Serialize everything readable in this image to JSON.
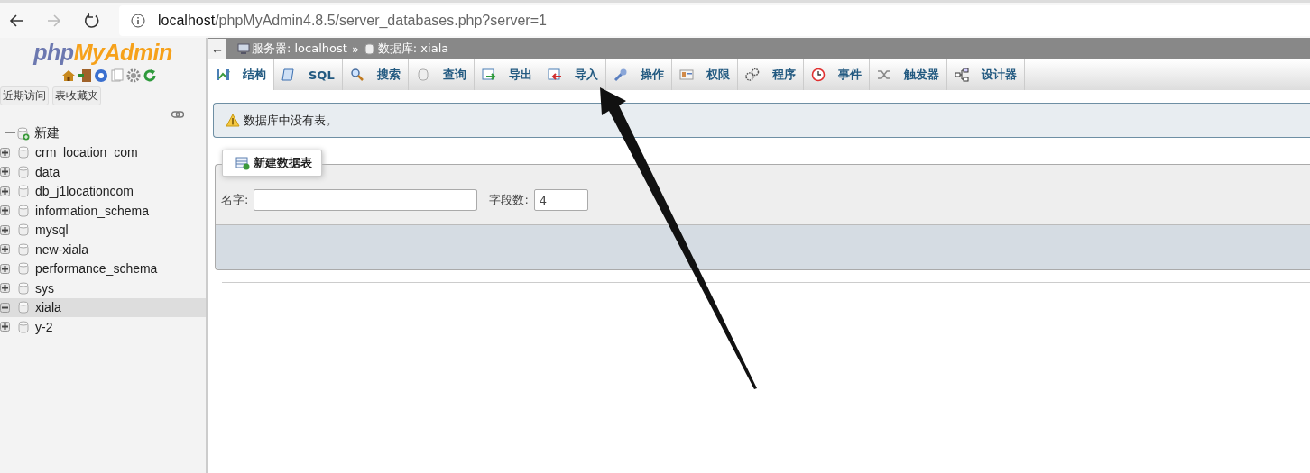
{
  "browser": {
    "url_host": "localhost",
    "url_path": "/phpMyAdmin4.8.5/server_databases.php?server=1"
  },
  "sidebar": {
    "logo_php": "php",
    "logo_myadmin": "MyAdmin",
    "buttons": [
      {
        "label": "近期访问"
      },
      {
        "label": "表收藏夹"
      }
    ],
    "tree": [
      {
        "kind": "new",
        "label": "新建",
        "selected": false
      },
      {
        "kind": "database",
        "label": "crm_location_com",
        "expanded": false,
        "selected": false
      },
      {
        "kind": "database",
        "label": "data",
        "expanded": false,
        "selected": false
      },
      {
        "kind": "database",
        "label": "db_j1locationcom",
        "expanded": false,
        "selected": false
      },
      {
        "kind": "database",
        "label": "information_schema",
        "expanded": false,
        "selected": false
      },
      {
        "kind": "database",
        "label": "mysql",
        "expanded": false,
        "selected": false
      },
      {
        "kind": "database",
        "label": "new-xiala",
        "expanded": false,
        "selected": false
      },
      {
        "kind": "database",
        "label": "performance_schema",
        "expanded": false,
        "selected": false
      },
      {
        "kind": "database",
        "label": "sys",
        "expanded": false,
        "selected": false
      },
      {
        "kind": "database",
        "label": "xiala",
        "expanded": true,
        "selected": true
      },
      {
        "kind": "database",
        "label": "y-2",
        "expanded": false,
        "selected": false
      }
    ]
  },
  "breadcrumb": {
    "back": "←",
    "separator": "»",
    "items": [
      {
        "kind": "server",
        "label": "服务器: localhost"
      },
      {
        "kind": "database",
        "label": "数据库: xiala"
      }
    ]
  },
  "tabs": [
    {
      "label": "结构",
      "selected": true
    },
    {
      "label": "SQL",
      "selected": false
    },
    {
      "label": "搜索",
      "selected": false
    },
    {
      "label": "查询",
      "selected": false
    },
    {
      "label": "导出",
      "selected": false
    },
    {
      "label": "导入",
      "selected": false
    },
    {
      "label": "操作",
      "selected": false
    },
    {
      "label": "权限",
      "selected": false
    },
    {
      "label": "程序",
      "selected": false
    },
    {
      "label": "事件",
      "selected": false
    },
    {
      "label": "触发器",
      "selected": false
    },
    {
      "label": "设计器",
      "selected": false
    }
  ],
  "notice": {
    "text": "数据库中没有表。"
  },
  "create_table": {
    "legend": "新建数据表",
    "name_label": "名字:",
    "fields_label": "字段数:",
    "fields_value": "4"
  }
}
